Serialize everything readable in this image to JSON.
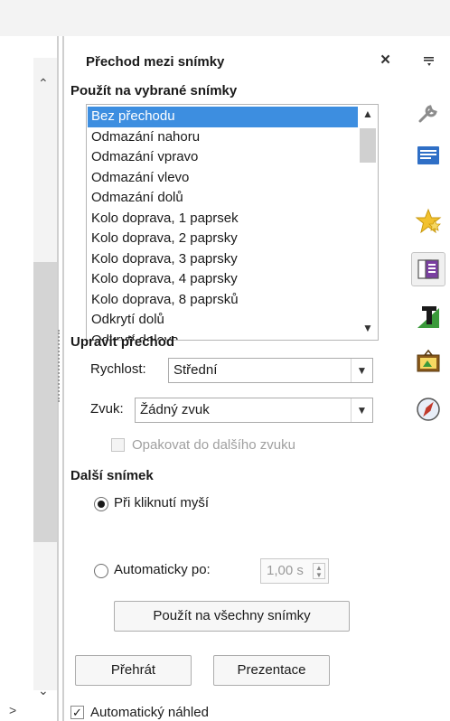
{
  "panel": {
    "title": "Přechod mezi snímky",
    "close_symbol": "×"
  },
  "apply_section": {
    "title": "Použít na vybrané snímky",
    "transitions": [
      "Bez přechodu",
      "Odmazání nahoru",
      "Odmazání vpravo",
      "Odmazání vlevo",
      "Odmazání dolů",
      "Kolo doprava, 1 paprsek",
      "Kolo doprava, 2 paprsky",
      "Kolo doprava, 3 paprsky",
      "Kolo doprava, 4 paprsky",
      "Kolo doprava, 8 paprsků",
      "Odkrytí dolů",
      "Odkrytí doleva"
    ],
    "selected_index": 0
  },
  "modify_section": {
    "title": "Upravit přechod",
    "speed_label": "Rychlost:",
    "speed_value": "Střední",
    "sound_label": "Zvuk:",
    "sound_value": "Žádný zvuk",
    "loop_label": "Opakovat do dalšího zvuku",
    "loop_checked": false,
    "loop_enabled": false
  },
  "next_slide_section": {
    "title": "Další snímek",
    "on_click_label": "Při kliknutí myší",
    "auto_label": "Automaticky po:",
    "auto_value": "1,00 s",
    "selected": "on_click"
  },
  "buttons": {
    "apply_all": "Použít na všechny snímky",
    "play": "Přehrát",
    "slideshow": "Prezentace"
  },
  "preview": {
    "label": "Automatický náhled",
    "checked": true,
    "check_mark": "✓"
  },
  "sidebar_icons": [
    "menu-icon",
    "properties-wrench-icon",
    "slide-layouts-icon",
    "custom-animation-star-icon",
    "slide-transition-icon",
    "styles-icon",
    "gallery-icon",
    "navigator-icon"
  ],
  "colors": {
    "selection": "#3d8ee0",
    "accent_blue": "#2f6fc6",
    "accent_green": "#3a9a3a",
    "accent_yellow": "#f2c12e"
  }
}
